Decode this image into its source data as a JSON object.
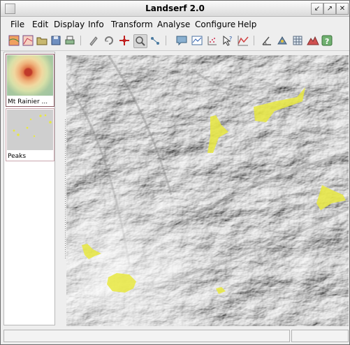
{
  "window": {
    "title": "Landserf 2.0"
  },
  "menu": [
    {
      "label": "File"
    },
    {
      "label": "Edit"
    },
    {
      "label": "Display"
    },
    {
      "label": "Info"
    },
    {
      "label": "Transform"
    },
    {
      "label": "Analyse"
    },
    {
      "label": "Configure"
    },
    {
      "label": "Help"
    }
  ],
  "toolbar_icons": [
    "new-raster-icon",
    "new-vector-icon",
    "open-icon",
    "save-icon",
    "print-icon",
    "edit-pencil-icon",
    "refresh-icon",
    "crosshair-icon",
    "zoom-icon",
    "pan-icon",
    "speech-bubble-icon",
    "profile-icon",
    "scatter-icon",
    "query-icon",
    "graph-icon",
    "measure-angle-icon",
    "feature-icon",
    "grid-icon",
    "peaks-icon",
    "help-icon"
  ],
  "thumbnails": [
    {
      "label": "Mt Rainier ..."
    },
    {
      "label": "Peaks"
    }
  ],
  "status": {
    "left": "",
    "right": ""
  },
  "colors": {
    "peak_highlight": "#e8e840",
    "selected_border": "#8a5a63"
  }
}
